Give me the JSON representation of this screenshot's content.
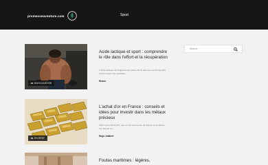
{
  "header": {
    "site_name": "promesseaventure.com",
    "nav": [
      "Sport"
    ]
  },
  "search": {
    "placeholder": "Search..."
  },
  "posts": [
    {
      "category_tag": "MUSCULATION",
      "title": "Acide lactique et sport : comprendre le rôle dans l'effort et la récupération",
      "excerpt": "L'acide lactique fait régulièrement parler de lui dans les cercles sportifs, souvent avec une réputation ...",
      "category": "Muscu"
    },
    {
      "category_tag": "EN BREF",
      "title": "L'achat d'or en France : conseils et idées pour investir dans les métaux précieux",
      "excerpt": "Opter pour l'achat d'or, que ce soit sous forme de lingots ou de pièces, est devenu un ...",
      "category": "Hugo Jolabert"
    },
    {
      "title": "Foutas maritimes : légères,"
    }
  ],
  "colors": {
    "header_bg": "#161616",
    "page_bg": "#f2f2f2"
  }
}
